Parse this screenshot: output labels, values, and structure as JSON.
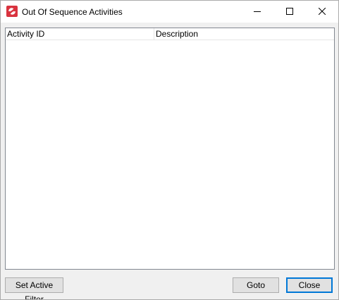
{
  "window": {
    "title": "Out Of Sequence Activities",
    "icon": "app-logo-icon"
  },
  "title_controls": {
    "minimize_icon": "minimize-icon",
    "maximize_icon": "maximize-icon",
    "close_icon": "close-icon"
  },
  "list": {
    "columns": [
      "Activity ID",
      "Description"
    ],
    "rows": []
  },
  "buttons": {
    "set_active_filter": "Set Active Filter",
    "goto": "Goto",
    "close": "Close"
  },
  "colors": {
    "app_icon": "#d9333f",
    "default_button_border": "#0078d7"
  }
}
